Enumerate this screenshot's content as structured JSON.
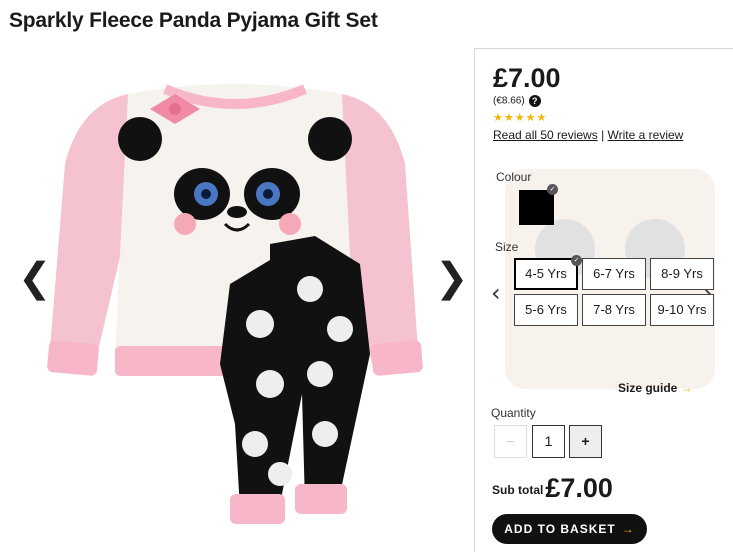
{
  "product": {
    "title": "Sparkly Fleece Panda Pyjama Gift Set",
    "price": "£7.00",
    "price_alt": "(€8.66)",
    "rating_stars": "★★★★★",
    "reviews_link": "Read all 50 reviews",
    "separator": "|",
    "write_review_link": "Write a review"
  },
  "gallery": {
    "prev_glyph": "❮",
    "next_glyph": "❯"
  },
  "colour": {
    "label": "Colour",
    "selected_hex": "#000000"
  },
  "size": {
    "label": "Size",
    "options": [
      "4-5 Yrs",
      "6-7 Yrs",
      "8-9 Yrs",
      "5-6 Yrs",
      "7-8 Yrs",
      "9-10 Yrs"
    ],
    "selected": "4-5 Yrs",
    "guide_label": "Size guide",
    "guide_arrow": "→"
  },
  "quantity": {
    "label": "Quantity",
    "minus": "−",
    "value": "1",
    "plus": "+"
  },
  "subtotal": {
    "label": "Sub total",
    "value": "£7.00"
  },
  "basket": {
    "label": "ADD TO BASKET",
    "arrow": "→"
  },
  "colors": {
    "accent": "#f4b400",
    "button": "#111111",
    "pink": "#f5c2cf"
  }
}
